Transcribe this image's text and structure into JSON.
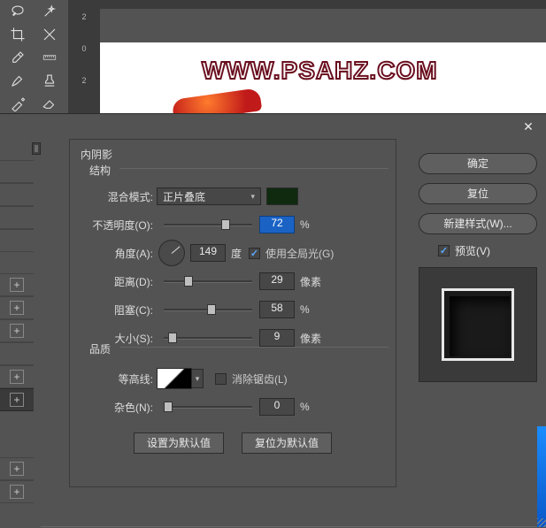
{
  "ruler": {
    "t1": "2",
    "t2": "0",
    "t3": "2"
  },
  "canvas": {
    "watermark": "WWW.PSAHZ.COM"
  },
  "dialog": {
    "section": "内阴影",
    "structure": "结构",
    "blendMode": {
      "label": "混合模式:",
      "value": "正片叠底"
    },
    "color": "#102a10",
    "opacity": {
      "label": "不透明度(O):",
      "value": "72",
      "unit": "%",
      "handlePct": 72
    },
    "angle": {
      "label": "角度(A):",
      "value": "149",
      "unit": "度"
    },
    "globalLight": {
      "label": "使用全局光(G)",
      "checked": true
    },
    "distance": {
      "label": "距离(D):",
      "value": "29",
      "unit": "像素",
      "handlePct": 26
    },
    "choke": {
      "label": "阻塞(C):",
      "value": "58",
      "unit": "%",
      "handlePct": 54
    },
    "size": {
      "label": "大小(S):",
      "value": "9",
      "unit": "像素",
      "handlePct": 6
    },
    "quality": "品质",
    "contour": {
      "label": "等高线:"
    },
    "antiAlias": {
      "label": "消除锯齿(L)",
      "checked": false
    },
    "noise": {
      "label": "杂色(N):",
      "value": "0",
      "unit": "%",
      "handlePct": 0
    },
    "setDefault": "设置为默认值",
    "resetDefault": "复位为默认值"
  },
  "right": {
    "ok": "确定",
    "cancel": "复位",
    "newStyle": "新建样式(W)...",
    "preview": "预览(V)"
  }
}
